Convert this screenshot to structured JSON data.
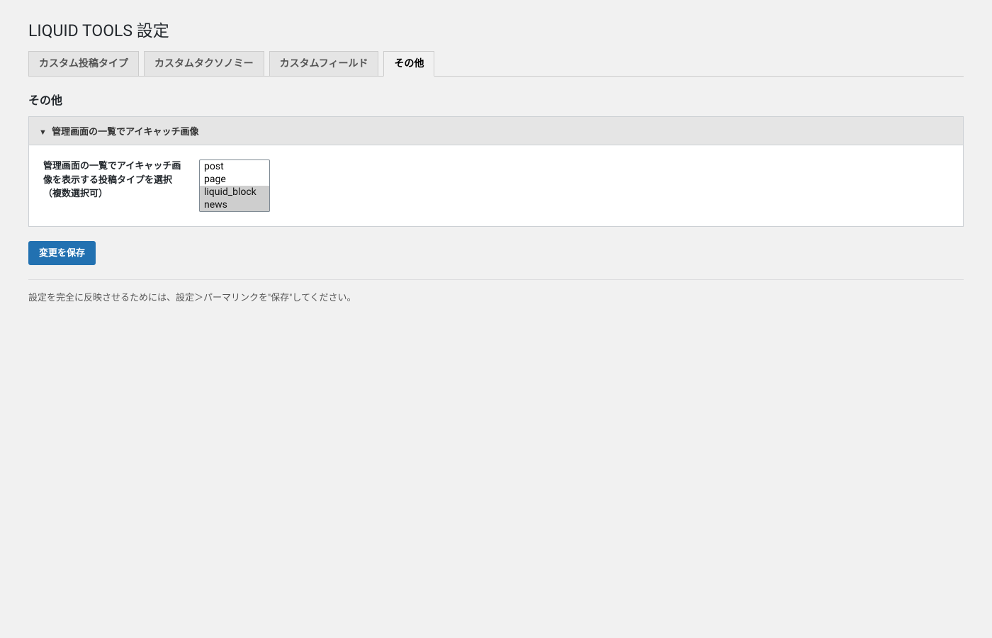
{
  "page_title": "LIQUID TOOLS 設定",
  "tabs": [
    {
      "label": "カスタム投稿タイプ",
      "active": false
    },
    {
      "label": "カスタムタクソノミー",
      "active": false
    },
    {
      "label": "カスタムフィールド",
      "active": false
    },
    {
      "label": "その他",
      "active": true
    }
  ],
  "section_title": "その他",
  "panel": {
    "header": "管理画面の一覧でアイキャッチ画像",
    "field_label": "管理画面の一覧でアイキャッチ画像を表示する投稿タイプを選択 （複数選択可）",
    "options": [
      {
        "value": "post",
        "selected": false
      },
      {
        "value": "page",
        "selected": false
      },
      {
        "value": "liquid_block",
        "selected": true
      },
      {
        "value": "news",
        "selected": true
      }
    ]
  },
  "save_button": "変更を保存",
  "footer_note": "設定を完全に反映させるためには、設定＞パーマリンクを\"保存\"してください。"
}
